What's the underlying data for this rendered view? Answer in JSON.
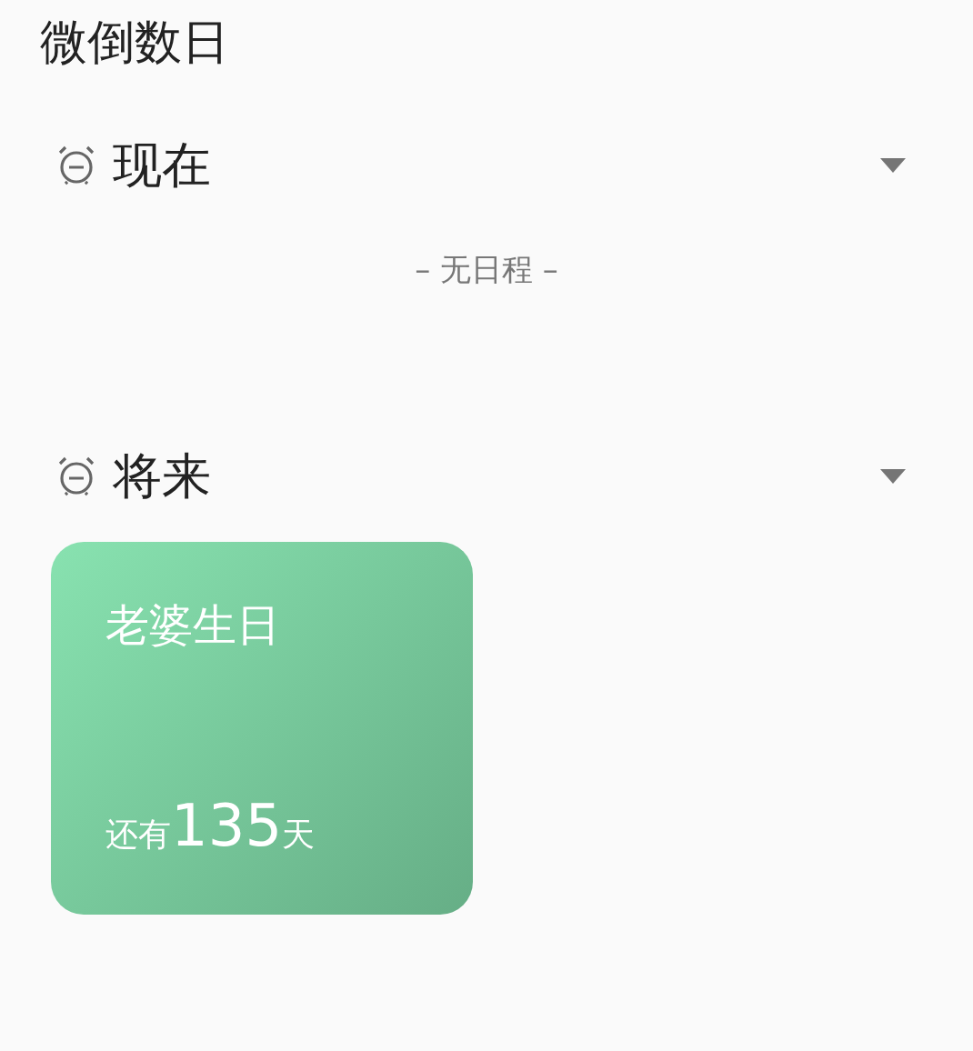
{
  "app_title": "微倒数日",
  "sections": [
    {
      "label": "现在",
      "expanded": true,
      "empty_text": "– 无日程 –"
    },
    {
      "label": "将来",
      "expanded": true,
      "events": [
        {
          "title": "老婆生日",
          "prefix": "还有",
          "days": "135",
          "suffix": "天"
        }
      ]
    }
  ]
}
